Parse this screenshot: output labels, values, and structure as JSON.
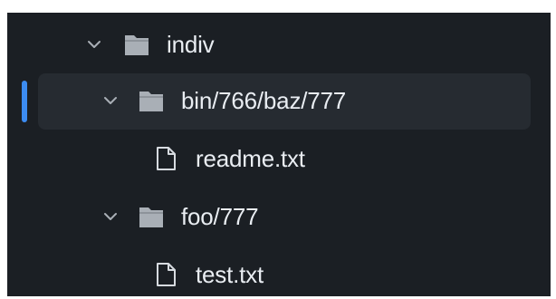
{
  "tree": {
    "items": [
      {
        "label": "indiv",
        "type": "folder",
        "expanded": true,
        "icon": "folder-icon"
      },
      {
        "label": "bin/766/baz/777",
        "type": "folder",
        "expanded": true,
        "selected": true,
        "icon": "folder-icon"
      },
      {
        "label": "readme.txt",
        "type": "file",
        "icon": "file-icon"
      },
      {
        "label": "foo/777",
        "type": "folder",
        "expanded": true,
        "icon": "folder-icon"
      },
      {
        "label": "test.txt",
        "type": "file",
        "icon": "file-icon"
      }
    ]
  },
  "colors": {
    "background": "#1b1f24",
    "selected_row": "#262b31",
    "active_indicator": "#3c8cf2",
    "text": "#e9edf2",
    "icon": "#a9afb6"
  }
}
